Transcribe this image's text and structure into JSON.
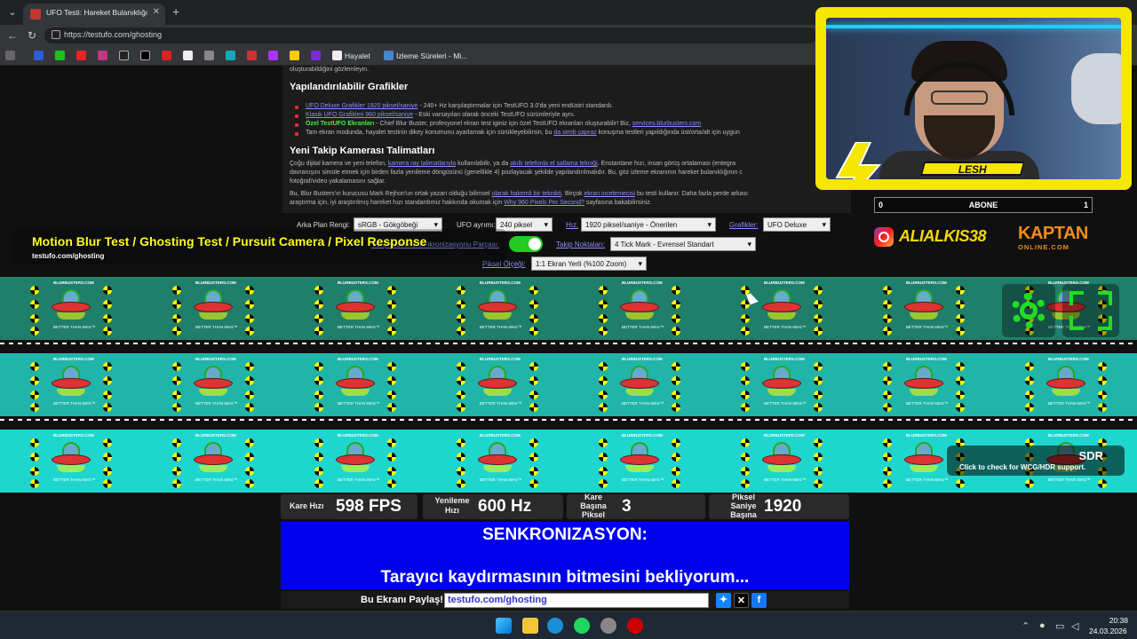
{
  "browser": {
    "tab_title": "UFO Testi: Hareket Bulanıklığı Testi",
    "tab_close": "✕",
    "new_tab": "+",
    "url": "https://testufo.com/ghosting",
    "bookmarks": [
      {
        "label": "Hayalet"
      },
      {
        "label": "İzleme Süreleri - Mi..."
      }
    ]
  },
  "article": {
    "line_top": "oluşturabildiğini gözlemleyin.",
    "section1_title": "Yapılandırılabilir Grafikler",
    "items": [
      {
        "link": "UFO Deluxe Grafikler 1920 piksel/saniye",
        "text": " - 240+ Hz karşılaştırmalar için TestUFO 3.0'da yeni endüstri standardı."
      },
      {
        "link": "Klasik UFO Grafikleri 960 piksel/saniye",
        "text": " - Eski varsayılan olarak önceki TestUFO sürümleriyle aynı."
      },
      {
        "link": "Özel TestUFO Ekranları",
        "text": " - Chief Blur Buster, profesyonel ekran test iginiz için özel TestUFO ekranları oluşturabilir! Biz, ",
        "link2": "services.blurbusters.com"
      },
      {
        "link": "",
        "text": "Tam ekran modunda, hayalet testinin dikey konumunu ayarlamak için sürükleyebilirsin, bu ",
        "link2": "da strob çapraz",
        "text2": " konuşma testleri yapıldığında üst/orta/alt için uygun"
      }
    ],
    "section2_title": "Yeni Takip Kamerası Talimatları",
    "para1_a": "Çoğu dijital kamera ve yeni telefon, ",
    "para1_link": "kamera ray talimatlarıyla",
    "para1_b": " kullanılabilir, ya da ",
    "para1_link2": "akıllı telefonla el sallama tekniği",
    "para1_c": ". Enstantane hızı, insan görüş ortalaması (entegra",
    "para1_line2": "davranışını simüle etmek için birden fazla yenileme döngüsünü (genellikle 4) pozlayacak şekilde yapılandırılmalıdır. Bu, göz izleme ekranının hareket bulanıklığının c",
    "para1_line3": "fotoğraf/video yakalamasını sağlar.",
    "para2_a": "Bu, Blur Busters'ın kurucusu Mark Rejhon'un ortak yazarı olduğu bilimsel ",
    "para2_link": "olarak hakemli bir teknikti",
    "para2_b": ". Birçok ",
    "para2_link2": "ekran incelemecisi",
    "para2_c": " bu testi kullanır. Daha fazla perde arkası",
    "para2_line2_a": "araştırma için, iyi araştırılmış hareket hızı standardımız hakkında okumak için ",
    "para2_line2_link": "Why 960 Pixels Per Second?",
    "para2_line2_b": " sayfasına bakabilirsiniz."
  },
  "controls": {
    "bg_label": "Arka Plan Rengi:",
    "bg_value": "sRGB - Gökgöbeği",
    "ufo_sep_label": "UFO ayrımı:",
    "ufo_sep_value": "240 piksel",
    "speed_label": "Hız:",
    "speed_value": "1920 piksel/saniye - Önerilen",
    "graphics_label": "Grafikler:",
    "graphics_value": "UFO Deluxe",
    "sync_label": "Takip Kamera Senkronizasyonu Parçası:",
    "sync_toggle_on": true,
    "tick_label": "Takip Noktaları:",
    "tick_value": "4 Tick Mark - Evrensel Standart",
    "scale_label": "Piksel Ölçeği:",
    "scale_value": "1:1 Ekran Yerli (%100 Zoom)"
  },
  "lanes": {
    "ufo_brand": "BLURBUSTERS.COM",
    "ufo_tagline": "BETTER THAN 60Hz™",
    "lane_colors": [
      "#1f7f6a",
      "#20b5a8",
      "#1fd6cf"
    ],
    "banner_title": "Motion Blur Test / Ghosting Test / Pursuit Camera / Pixel Response",
    "banner_sub": "testufo.com/ghosting",
    "sdr_title": "SDR",
    "sdr_sub": "Click to check for WCG/HDR support."
  },
  "stats": {
    "fps_label": "Kare Hızı",
    "fps_value": "598 FPS",
    "refresh_label_1": "Yenileme",
    "refresh_label_2": "Hızı",
    "refresh_value": "600 Hz",
    "ppf_label_1": "Kare",
    "ppf_label_2": "Başına",
    "ppf_label_3": "Piksel",
    "ppf_value": "3",
    "pps_label_1": "Piksel",
    "pps_label_2": "Saniye",
    "pps_label_3": "Başına",
    "pps_value": "1920"
  },
  "sync": {
    "title": "SENKRONIZASYON:",
    "message": "Tarayıcı kaydırmasının bitmesini bekliyorum..."
  },
  "share": {
    "label": "Bu Ekranı Paylaş!",
    "url": "testufo.com/ghosting"
  },
  "overlay": {
    "streamer_name": "LESH",
    "sub_left": "0",
    "sub_center": "ABONE",
    "sub_right": "1",
    "instagram": "ALIALKIS38",
    "sponsor": "KAPTAN",
    "sponsor_sub": "ONLINE.COM"
  },
  "taskbar": {
    "time": "20:38",
    "date": "24.03.2026"
  }
}
